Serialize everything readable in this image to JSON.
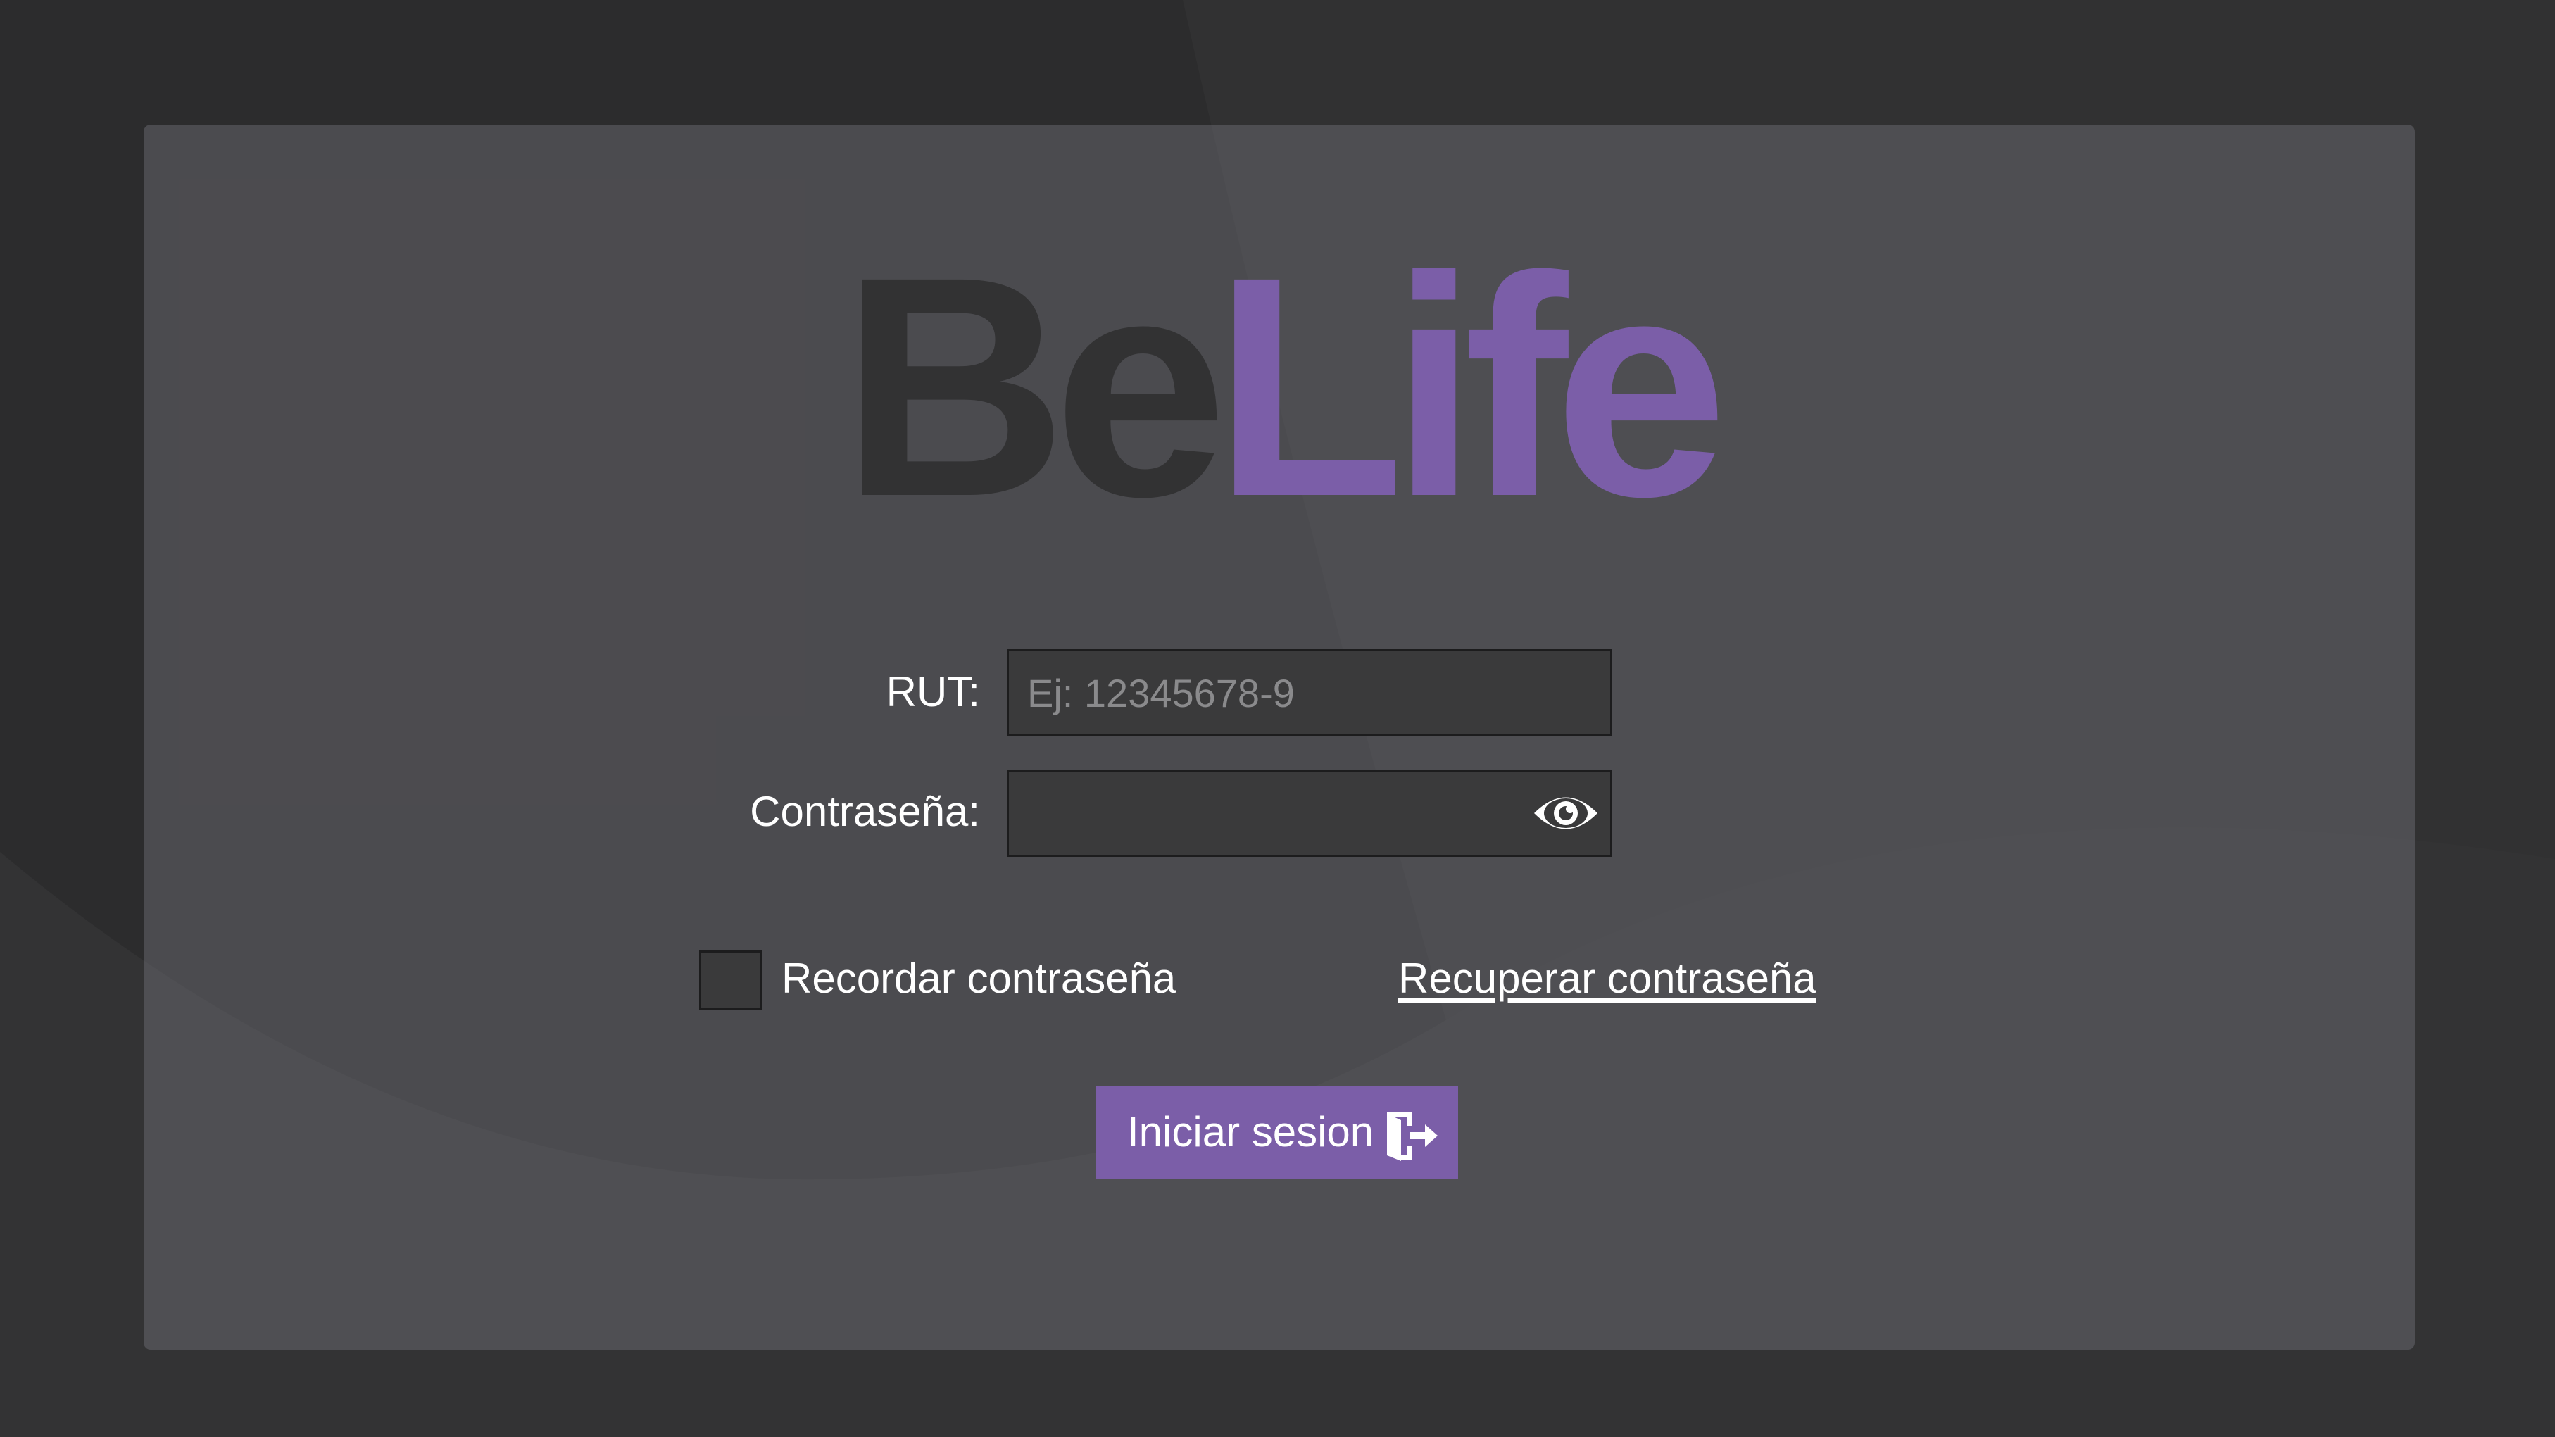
{
  "app": {
    "brand_part1": "Be",
    "brand_part2": "Life"
  },
  "form": {
    "rut_label": "RUT:",
    "rut_placeholder": "Ej: 12345678-9",
    "rut_value": "",
    "password_label": "Contraseña:",
    "password_value": "",
    "password_toggle_icon": "eye-icon",
    "remember_label": "Recordar contraseña",
    "remember_checked": false,
    "recover_link": "Recuperar contraseña",
    "submit_label": "Iniciar sesion",
    "submit_icon": "login-door-icon"
  },
  "colors": {
    "accent": "#7b5ea8",
    "background": "#2c2c2d",
    "input_bg": "#3a3a3b",
    "logo_dark": "#323233"
  }
}
